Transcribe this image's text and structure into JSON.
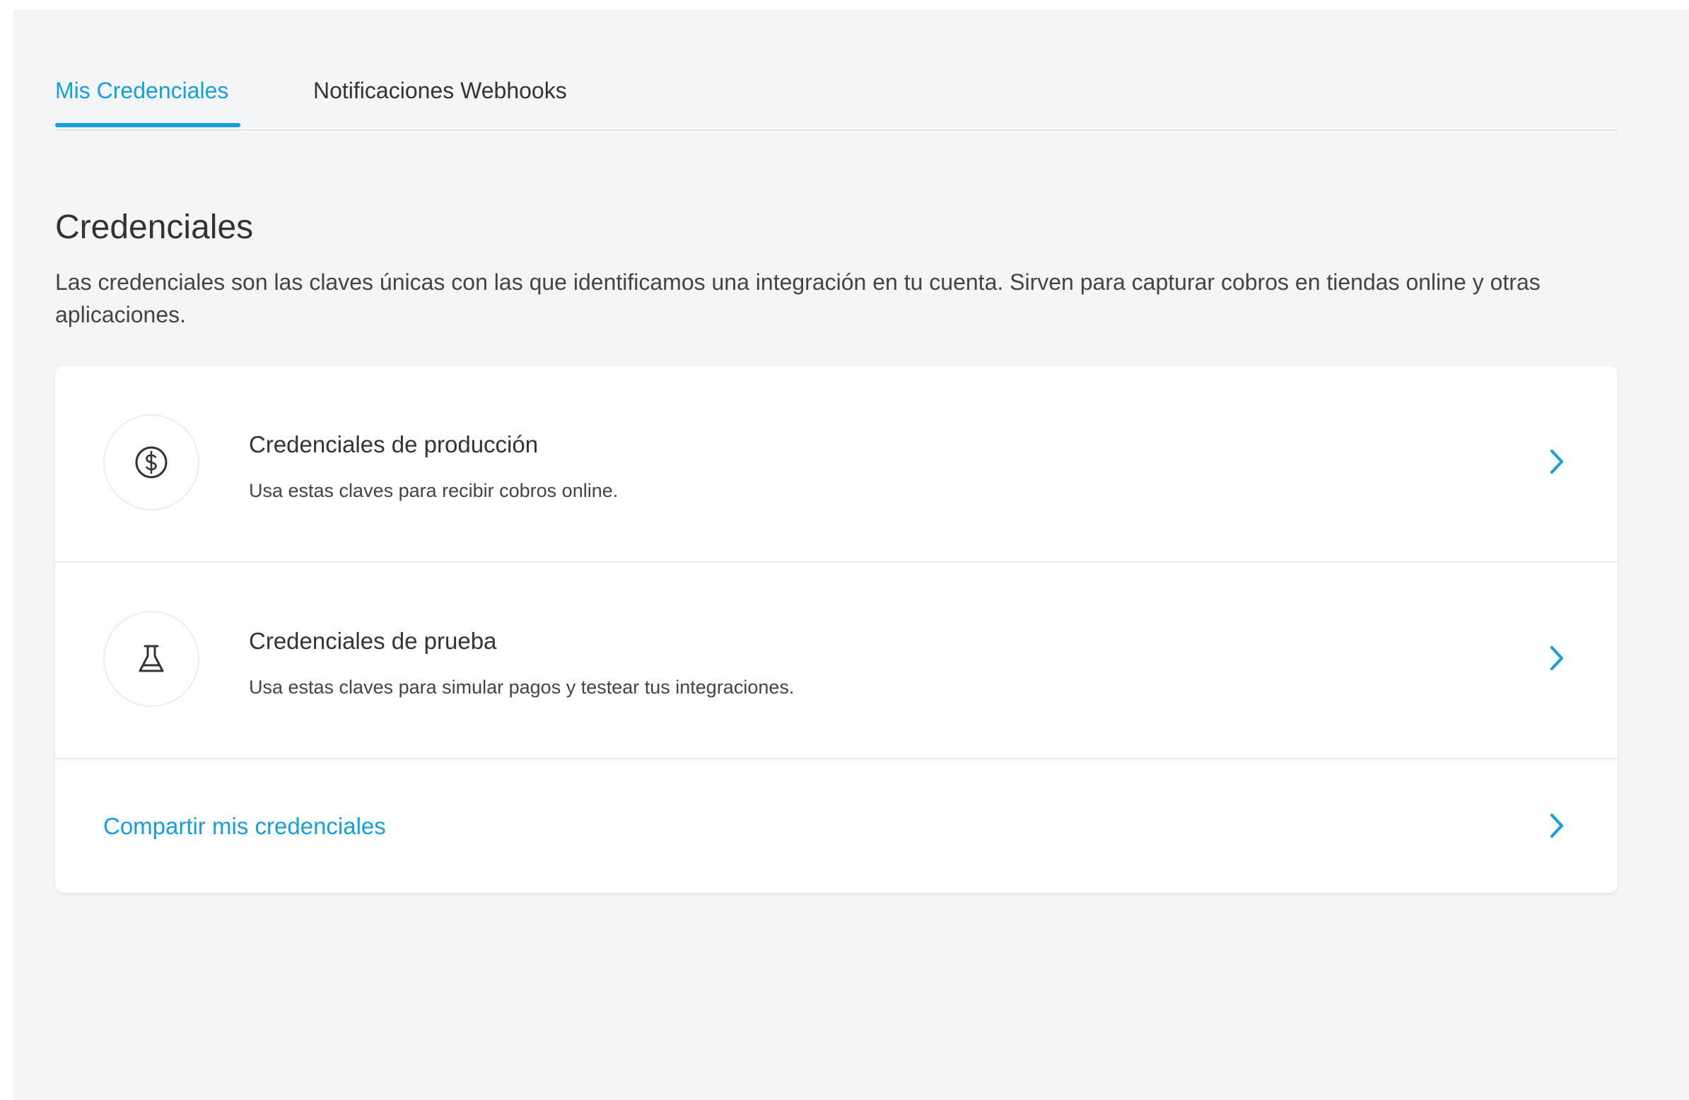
{
  "tabs": [
    {
      "label": "Mis Credenciales",
      "active": true
    },
    {
      "label": "Notificaciones Webhooks",
      "active": false
    }
  ],
  "section": {
    "title": "Credenciales",
    "description": "Las credenciales son las claves únicas con las que identificamos una integración en tu cuenta. Sirven para capturar cobros en tiendas online y otras aplicaciones."
  },
  "items": [
    {
      "icon": "dollar-coin-icon",
      "title": "Credenciales de producción",
      "subtitle": "Usa estas claves para recibir cobros online."
    },
    {
      "icon": "flask-icon",
      "title": "Credenciales de prueba",
      "subtitle": "Usa estas claves para simular pagos y testear tus integraciones."
    }
  ],
  "share": {
    "label": "Compartir mis credenciales"
  },
  "colors": {
    "accent": "#159ee0",
    "background": "#f4f5f7",
    "card": "#ffffff",
    "text": "#333333"
  }
}
